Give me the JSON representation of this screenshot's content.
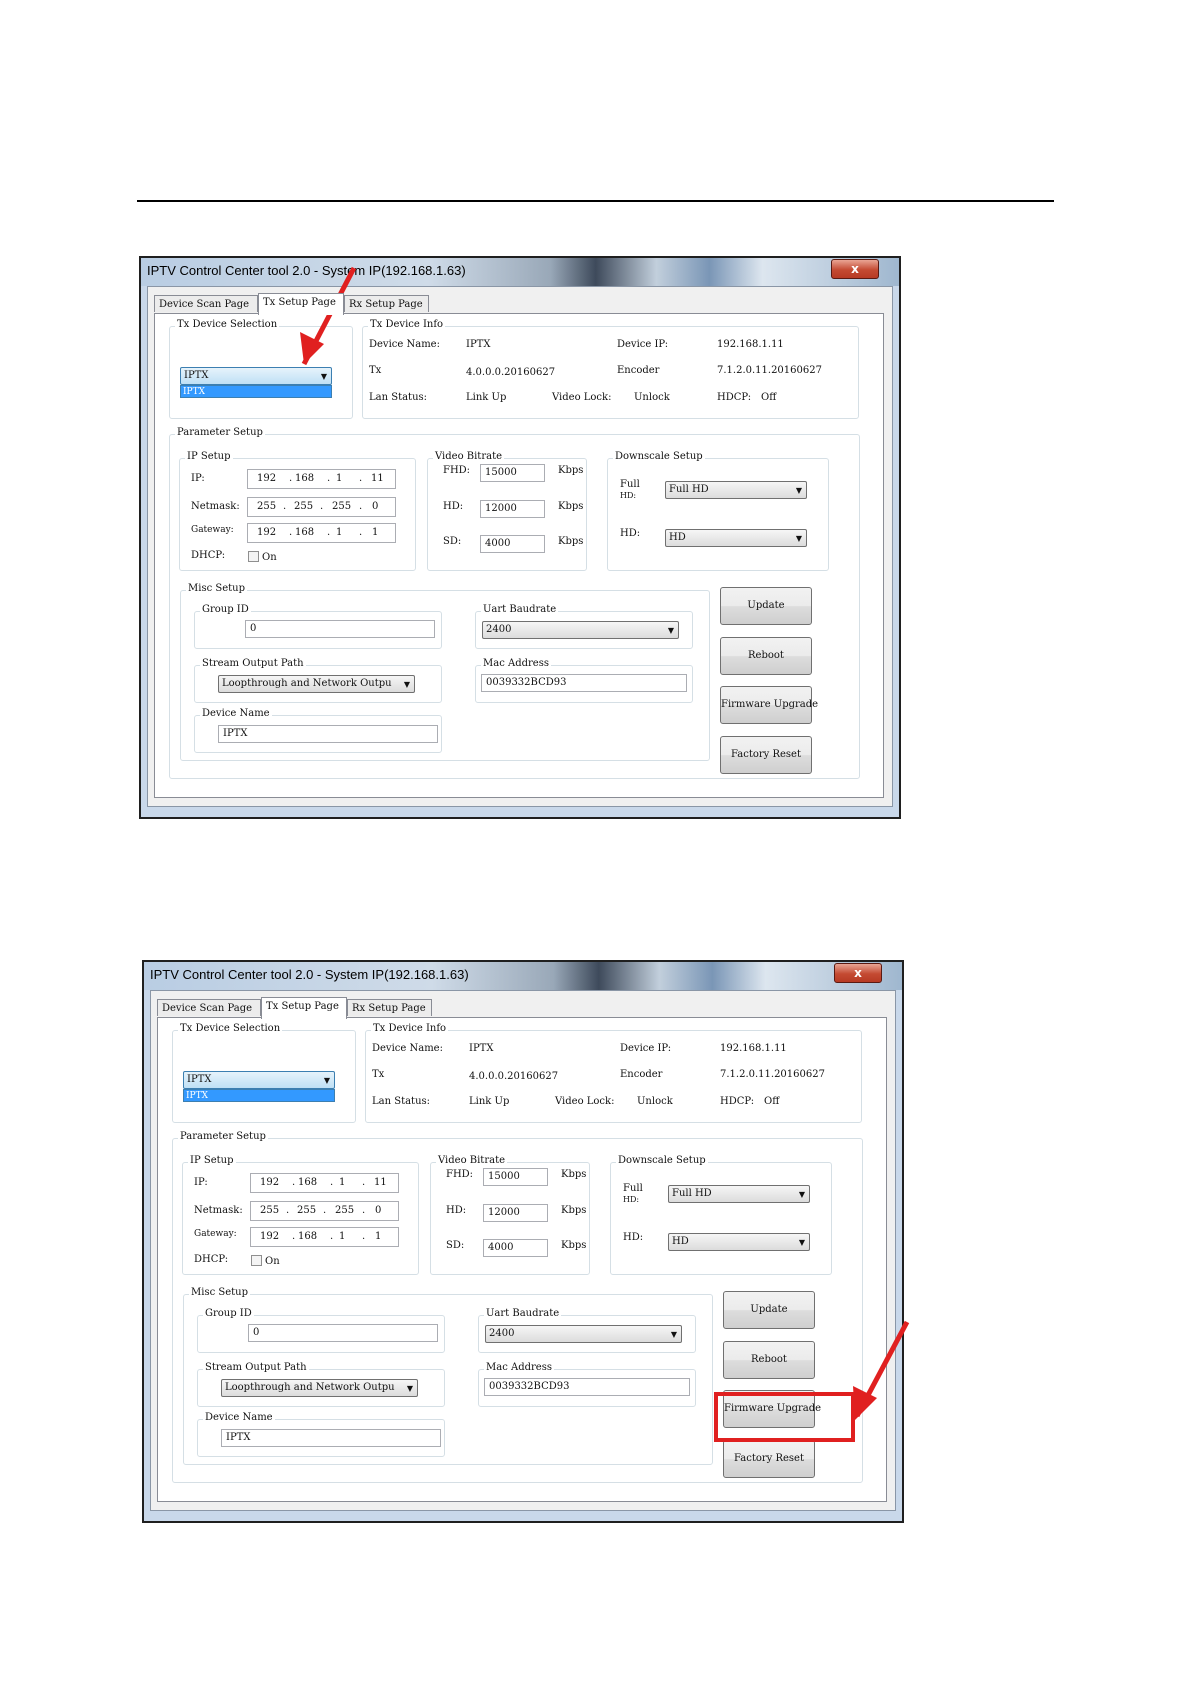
{
  "window": {
    "title": "IPTV Control Center tool 2.0 - System IP(192.168.1.63)",
    "close_label": "x",
    "tabs": [
      "Device Scan Page",
      "Tx Setup Page",
      "Rx Setup Page"
    ],
    "tx_device_selection": {
      "group_label": "Tx Device Selection",
      "selected": "IPTX",
      "options": [
        "IPTX"
      ]
    },
    "tx_device_info": {
      "group_label": "Tx Device Info",
      "device_name_label": "Device Name:",
      "device_name": "IPTX",
      "device_ip_label": "Device IP:",
      "device_ip": "192.168.1.11",
      "tx_label": "Tx",
      "tx_version": "4.0.0.0.20160627",
      "encoder_label": "Encoder",
      "encoder_version": "7.1.2.0.11.20160627",
      "lan_status_label": "Lan Status:",
      "lan_status": "Link Up",
      "video_lock_label": "Video Lock:",
      "video_lock": "Unlock",
      "hdcp_label": "HDCP:",
      "hdcp": "Off"
    },
    "parameter_setup": {
      "group_label": "Parameter Setup",
      "ip_setup": {
        "group_label": "IP Setup",
        "ip_label": "IP:",
        "ip": [
          "192",
          "168",
          "1",
          "11"
        ],
        "netmask_label": "Netmask:",
        "netmask": [
          "255",
          "255",
          "255",
          "0"
        ],
        "gateway_label": "Gateway:",
        "gateway": [
          "192",
          "168",
          "1",
          "1"
        ],
        "dhcp_label": "DHCP:",
        "dhcp_on_label": "On",
        "dhcp_checked": false
      },
      "video_bitrate": {
        "group_label": "Video Bitrate",
        "fhd_label": "FHD:",
        "fhd": "15000",
        "hd_label": "HD:",
        "hd": "12000",
        "sd_label": "SD:",
        "sd": "4000",
        "unit": "Kbps"
      },
      "downscale_setup": {
        "group_label": "Downscale Setup",
        "full_hd_label_1": "Full",
        "full_hd_label_2": "HD:",
        "full_hd_value": "Full HD",
        "hd_label": "HD:",
        "hd_value": "HD"
      }
    },
    "misc_setup": {
      "group_label": "Misc Setup",
      "group_id_label": "Group ID",
      "group_id": "0",
      "uart_baudrate_label": "Uart Baudrate",
      "uart_baudrate": "2400",
      "stream_output_path_label": "Stream Output Path",
      "stream_output_path": "Loopthrough and Network Outpu",
      "mac_address_label": "Mac Address",
      "mac_address": "0039332BCD93",
      "device_name_label": "Device Name",
      "device_name": "IPTX"
    },
    "buttons": {
      "update": "Update",
      "reboot": "Reboot",
      "firmware_upgrade": "Firmware Upgrade",
      "factory_reset": "Factory Reset"
    }
  },
  "annotations": {
    "color": "#e02020"
  }
}
